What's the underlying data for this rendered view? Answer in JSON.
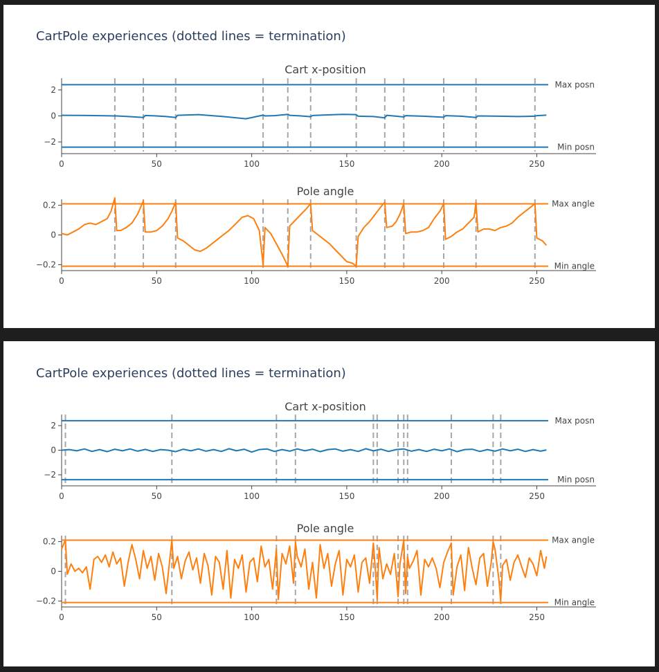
{
  "colors": {
    "position": "#1f77b4",
    "angle": "#ff7f0e",
    "termination": "#a6a6a6",
    "axis": "#444444",
    "title_text": "#2a3f5f",
    "panel_bg": "#ffffff",
    "page_bg": "#1e1e1e"
  },
  "chart_data": [
    {
      "type": "line",
      "title": "CartPole experiences (dotted lines = termination)",
      "subplots": [
        {
          "title": "Cart x-position",
          "xlim": [
            0,
            256
          ],
          "ylim": [
            -2.9,
            2.9
          ],
          "x_ticks": [
            "0",
            "50",
            "100",
            "150",
            "200",
            "250"
          ],
          "y_ticks": [
            {
              "value": 2,
              "label": "2"
            },
            {
              "value": 0,
              "label": "0"
            },
            {
              "value": -2,
              "label": "−2"
            }
          ],
          "thresholds": [
            {
              "label": "Max posn",
              "value": 2.4
            },
            {
              "label": "Min posn",
              "value": -2.4
            }
          ],
          "terminations": [
            28,
            43,
            60,
            106,
            119,
            131,
            155,
            170,
            180,
            201,
            218,
            249
          ],
          "series": {
            "x": [
              0,
              10,
              20,
              28,
              29,
              35,
              43,
              44,
              50,
              55,
              60,
              61,
              72,
              85,
              97,
              106,
              107,
              112,
              119,
              120,
              126,
              131,
              132,
              140,
              148,
              155,
              156,
              164,
              170,
              171,
              176,
              180,
              181,
              190,
              201,
              202,
              210,
              218,
              219,
              230,
              240,
              249,
              250,
              255
            ],
            "values": [
              0.05,
              0.04,
              0.02,
              0.0,
              0.0,
              -0.05,
              -0.12,
              0.03,
              0.0,
              -0.05,
              -0.12,
              0.05,
              0.1,
              -0.05,
              -0.22,
              0.06,
              0.0,
              0.02,
              0.12,
              0.05,
              0.0,
              -0.06,
              0.03,
              0.08,
              0.12,
              0.1,
              -0.02,
              -0.05,
              -0.15,
              0.05,
              -0.02,
              -0.08,
              0.02,
              -0.02,
              -0.1,
              0.02,
              -0.02,
              -0.12,
              0.0,
              -0.02,
              -0.05,
              -0.02,
              0.02,
              0.06
            ]
          }
        },
        {
          "title": "Pole angle",
          "xlim": [
            0,
            256
          ],
          "ylim": [
            -0.24,
            0.24
          ],
          "x_ticks": [
            "0",
            "50",
            "100",
            "150",
            "200",
            "250"
          ],
          "y_ticks": [
            {
              "value": 0.2,
              "label": "0.2"
            },
            {
              "value": 0,
              "label": "0"
            },
            {
              "value": -0.2,
              "label": "−0.2"
            }
          ],
          "thresholds": [
            {
              "label": "Max angle",
              "value": 0.21
            },
            {
              "label": "Min angle",
              "value": -0.21
            }
          ],
          "terminations": [
            28,
            43,
            60,
            106,
            119,
            131,
            155,
            170,
            180,
            201,
            218,
            249
          ],
          "series": {
            "x": [
              0,
              3,
              6,
              9,
              12,
              15,
              18,
              21,
              24,
              26,
              28,
              29,
              31,
              34,
              37,
              40,
              43,
              44,
              47,
              50,
              53,
              56,
              58,
              60,
              61,
              64,
              67,
              70,
              73,
              76,
              80,
              84,
              88,
              92,
              95,
              98,
              101,
              104,
              106,
              107,
              110,
              113,
              116,
              119,
              120,
              123,
              126,
              129,
              131,
              132,
              135,
              138,
              141,
              144,
              147,
              150,
              153,
              155,
              156,
              159,
              162,
              165,
              168,
              170,
              171,
              174,
              176,
              178,
              180,
              181,
              184,
              187,
              190,
              193,
              196,
              199,
              201,
              202,
              205,
              208,
              211,
              214,
              217,
              218,
              219,
              222,
              225,
              228,
              231,
              234,
              237,
              240,
              243,
              246,
              249,
              250,
              253,
              255
            ],
            "values": [
              0.01,
              0.0,
              0.02,
              0.04,
              0.07,
              0.08,
              0.07,
              0.09,
              0.11,
              0.16,
              0.25,
              0.03,
              0.03,
              0.05,
              0.08,
              0.14,
              0.23,
              0.02,
              0.02,
              0.03,
              0.06,
              0.11,
              0.16,
              0.22,
              -0.02,
              -0.04,
              -0.07,
              -0.1,
              -0.11,
              -0.09,
              -0.05,
              -0.01,
              0.03,
              0.08,
              0.12,
              0.13,
              0.11,
              0.03,
              -0.2,
              0.05,
              0.01,
              -0.06,
              -0.13,
              -0.21,
              0.06,
              0.1,
              0.14,
              0.18,
              0.21,
              0.03,
              0.0,
              -0.03,
              -0.06,
              -0.1,
              -0.14,
              -0.18,
              -0.19,
              -0.21,
              -0.01,
              0.05,
              0.09,
              0.14,
              0.19,
              0.22,
              0.05,
              0.06,
              0.09,
              0.14,
              0.21,
              0.01,
              0.02,
              0.02,
              0.03,
              0.05,
              0.11,
              0.16,
              0.21,
              -0.03,
              -0.01,
              0.02,
              0.04,
              0.08,
              0.12,
              0.22,
              0.02,
              0.04,
              0.04,
              0.03,
              0.05,
              0.06,
              0.08,
              0.12,
              0.15,
              0.18,
              0.21,
              -0.02,
              -0.04,
              -0.07
            ]
          }
        }
      ]
    },
    {
      "type": "line",
      "title": "CartPole experiences (dotted lines = termination)",
      "subplots": [
        {
          "title": "Cart x-position",
          "xlim": [
            0,
            256
          ],
          "ylim": [
            -2.9,
            2.9
          ],
          "x_ticks": [
            "0",
            "50",
            "100",
            "150",
            "200",
            "250"
          ],
          "y_ticks": [
            {
              "value": 2,
              "label": "2"
            },
            {
              "value": 0,
              "label": "0"
            },
            {
              "value": -2,
              "label": "−2"
            }
          ],
          "thresholds": [
            {
              "label": "Max posn",
              "value": 2.4
            },
            {
              "label": "Min posn",
              "value": -2.4
            }
          ],
          "terminations": [
            2,
            58,
            113,
            123,
            164,
            166,
            177,
            180,
            182,
            205,
            227,
            231
          ],
          "series": {
            "x": [
              0,
              4,
              8,
              12,
              16,
              20,
              24,
              28,
              32,
              36,
              40,
              44,
              48,
              52,
              56,
              60,
              64,
              68,
              72,
              76,
              80,
              84,
              88,
              92,
              96,
              100,
              104,
              108,
              112,
              116,
              120,
              124,
              128,
              132,
              136,
              140,
              144,
              148,
              152,
              156,
              160,
              164,
              168,
              172,
              176,
              180,
              184,
              188,
              192,
              196,
              200,
              204,
              208,
              212,
              216,
              220,
              224,
              228,
              232,
              236,
              240,
              244,
              248,
              252,
              255
            ],
            "values": [
              0.0,
              0.05,
              -0.05,
              0.1,
              -0.1,
              0.05,
              -0.12,
              0.08,
              -0.05,
              0.1,
              -0.08,
              0.06,
              -0.1,
              0.05,
              0.0,
              -0.12,
              0.08,
              -0.05,
              0.1,
              -0.08,
              0.05,
              -0.1,
              0.12,
              -0.05,
              0.08,
              -0.15,
              0.05,
              0.1,
              -0.1,
              0.05,
              -0.08,
              0.1,
              -0.05,
              0.08,
              -0.12,
              0.05,
              0.1,
              -0.08,
              0.05,
              -0.1,
              0.12,
              -0.05,
              0.08,
              -0.1,
              0.05,
              0.1,
              -0.08,
              0.05,
              -0.1,
              0.08,
              -0.05,
              0.1,
              -0.12,
              0.05,
              0.08,
              -0.1,
              0.05,
              -0.08,
              0.1,
              -0.05,
              0.08,
              -0.1,
              0.05,
              -0.08,
              0.02
            ]
          }
        },
        {
          "title": "Pole angle",
          "xlim": [
            0,
            256
          ],
          "ylim": [
            -0.24,
            0.24
          ],
          "x_ticks": [
            "0",
            "50",
            "100",
            "150",
            "200",
            "250"
          ],
          "y_ticks": [
            {
              "value": 0.2,
              "label": "0.2"
            },
            {
              "value": 0,
              "label": "0"
            },
            {
              "value": -0.2,
              "label": "−0.2"
            }
          ],
          "thresholds": [
            {
              "label": "Max angle",
              "value": 0.21
            },
            {
              "label": "Min angle",
              "value": -0.21
            }
          ],
          "terminations": [
            2,
            58,
            113,
            123,
            164,
            166,
            177,
            180,
            182,
            205,
            227,
            231
          ],
          "series": {
            "x": [
              0,
              2,
              3,
              5,
              7,
              9,
              11,
              13,
              15,
              17,
              19,
              21,
              23,
              25,
              27,
              29,
              31,
              33,
              35,
              37,
              39,
              41,
              43,
              45,
              47,
              49,
              51,
              53,
              55,
              57,
              58,
              59,
              61,
              63,
              65,
              67,
              69,
              71,
              73,
              75,
              77,
              79,
              81,
              83,
              85,
              87,
              89,
              91,
              93,
              95,
              97,
              99,
              101,
              103,
              105,
              107,
              109,
              111,
              113,
              114,
              116,
              118,
              120,
              122,
              123,
              124,
              126,
              128,
              130,
              132,
              134,
              136,
              138,
              140,
              142,
              144,
              146,
              148,
              150,
              152,
              154,
              156,
              158,
              160,
              162,
              164,
              165,
              166,
              167,
              169,
              171,
              173,
              175,
              177,
              178,
              180,
              181,
              182,
              183,
              185,
              187,
              189,
              191,
              193,
              195,
              197,
              199,
              201,
              203,
              205,
              206,
              208,
              210,
              212,
              214,
              216,
              218,
              220,
              222,
              224,
              226,
              227,
              228,
              230,
              231,
              232,
              234,
              236,
              238,
              240,
              242,
              244,
              246,
              248,
              250,
              252,
              254,
              255
            ],
            "values": [
              0.15,
              0.21,
              -0.02,
              0.05,
              0.0,
              0.02,
              -0.01,
              0.03,
              -0.12,
              0.08,
              0.1,
              0.06,
              0.11,
              0.03,
              0.13,
              0.05,
              0.09,
              -0.1,
              0.06,
              0.18,
              0.08,
              -0.05,
              0.14,
              0.02,
              0.1,
              -0.06,
              0.12,
              0.03,
              -0.15,
              0.09,
              0.21,
              0.02,
              0.1,
              -0.05,
              0.07,
              0.13,
              0.01,
              0.09,
              -0.08,
              0.12,
              0.04,
              -0.16,
              0.1,
              0.06,
              -0.12,
              0.14,
              -0.18,
              0.08,
              0.02,
              0.11,
              -0.14,
              0.06,
              0.09,
              -0.07,
              0.17,
              0.03,
              0.08,
              -0.12,
              0.15,
              -0.19,
              0.12,
              0.05,
              0.17,
              -0.08,
              0.2,
              0.1,
              0.03,
              0.15,
              -0.12,
              0.06,
              -0.18,
              0.18,
              0.02,
              0.12,
              -0.1,
              0.05,
              0.14,
              -0.16,
              0.08,
              0.03,
              0.11,
              -0.14,
              0.06,
              0.09,
              -0.08,
              0.19,
              0.02,
              -0.19,
              0.16,
              -0.05,
              0.05,
              -0.02,
              0.12,
              -0.17,
              0.05,
              0.21,
              -0.15,
              0.1,
              0.02,
              0.07,
              0.14,
              -0.16,
              0.08,
              0.03,
              0.09,
              0.02,
              -0.11,
              0.06,
              0.13,
              0.19,
              -0.16,
              0.03,
              0.11,
              -0.13,
              0.16,
              0.02,
              -0.09,
              0.09,
              0.12,
              -0.1,
              0.06,
              0.2,
              0.15,
              -0.05,
              -0.2,
              0.04,
              0.08,
              -0.06,
              0.06,
              0.11,
              0.03,
              -0.04,
              0.09,
              0.05,
              -0.03,
              0.14,
              0.02,
              0.1,
              0.09
            ]
          }
        }
      ]
    }
  ]
}
